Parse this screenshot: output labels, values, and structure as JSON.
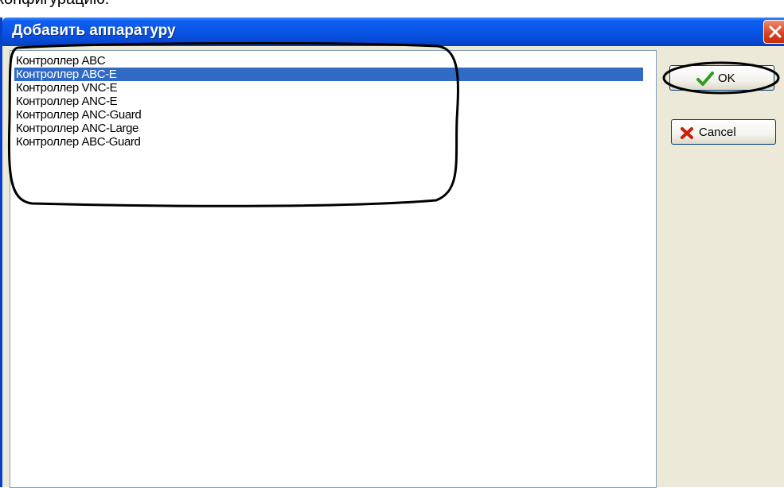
{
  "page": {
    "heading_fragment": "конфигурацию."
  },
  "dialog": {
    "title": "Добавить аппаратуру",
    "close_icon": "close-icon"
  },
  "list": {
    "items": [
      "Контроллер ABC",
      "Контроллер ABC-E",
      "Контроллер VNC-E",
      "Контроллер ANC-E",
      "Контроллер ANC-Guard",
      "Контроллер ANC-Large",
      "Контроллер ABC-Guard"
    ],
    "selected_item": "Контроллер ABC-E"
  },
  "buttons": {
    "ok_label": "OK",
    "ok_icon": "checkmark-icon",
    "cancel_label": "Cancel",
    "cancel_icon": "x-icon"
  },
  "colors": {
    "titlebar": "#0a55e6",
    "selection": "#316ac5",
    "dialog_face": "#ece9d8",
    "ok_check": "#2e9e1c",
    "cancel_x": "#c8200c"
  }
}
